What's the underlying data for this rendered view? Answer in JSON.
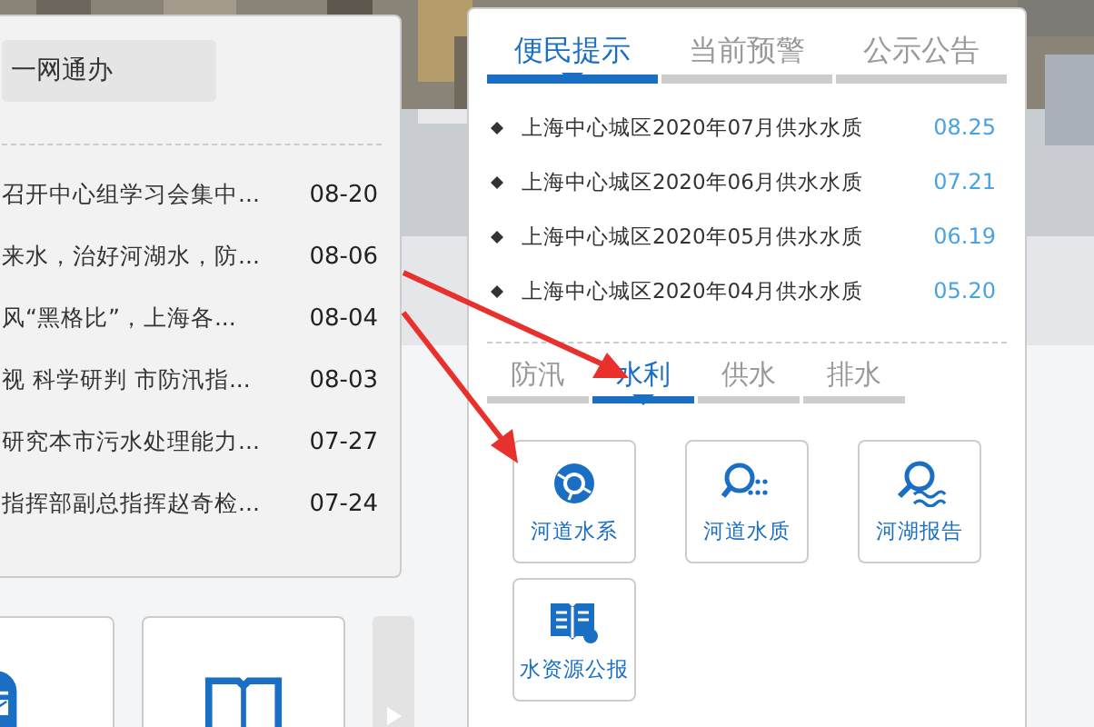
{
  "left_panel": {
    "button": "一网通办",
    "news": [
      {
        "title": "召开中心组学习会集中...",
        "date": "08-20"
      },
      {
        "title": "来水，治好河湖水，防...",
        "date": "08-06"
      },
      {
        "title": "风“黑格比”，上海各...",
        "date": "08-04"
      },
      {
        "title": "视 科学研判 市防汛指...",
        "date": "08-03"
      },
      {
        "title": "研究本市污水处理能力...",
        "date": "07-27"
      },
      {
        "title": "指挥部副总指挥赵奇检...",
        "date": "07-24"
      }
    ]
  },
  "bottom_cards": [
    {
      "kind": "mailbox"
    },
    {
      "kind": "book"
    }
  ],
  "right_panel": {
    "notice_tabs": [
      {
        "label": "便民提示",
        "selected": true
      },
      {
        "label": "当前预警",
        "selected": false
      },
      {
        "label": "公示公告",
        "selected": false
      }
    ],
    "notices": [
      {
        "title": "上海中心城区2020年07月供水水质",
        "date": "08.25"
      },
      {
        "title": "上海中心城区2020年06月供水水质",
        "date": "07.21"
      },
      {
        "title": "上海中心城区2020年05月供水水质",
        "date": "06.19"
      },
      {
        "title": "上海中心城区2020年04月供水水质",
        "date": "05.20"
      }
    ],
    "category_tabs": [
      {
        "label": "防汛",
        "selected": false
      },
      {
        "label": "水利",
        "selected": true
      },
      {
        "label": "供水",
        "selected": false
      },
      {
        "label": "排水",
        "selected": false
      }
    ],
    "tiles": [
      {
        "label": "河道水系",
        "kind": "globe"
      },
      {
        "label": "河道水质",
        "kind": "magnifier-dots"
      },
      {
        "label": "河湖报告",
        "kind": "magnifier-waves"
      },
      {
        "label": "水资源公报",
        "kind": "book-drop"
      }
    ]
  }
}
